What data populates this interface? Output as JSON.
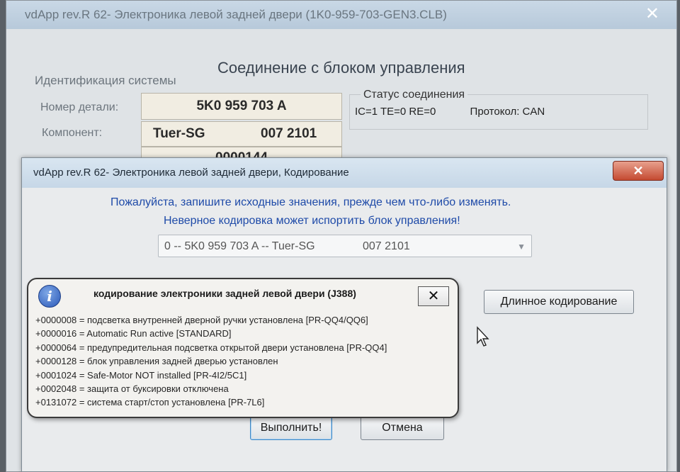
{
  "background_window": {
    "title": "vdApp rev.R 62- Электроника левой задней двери (1K0-959-703-GEN3.CLB)",
    "close_glyph": "✕",
    "heading": "Соединение с блоком управления",
    "system_id": {
      "group_label": "Идентификация системы",
      "part_number_label": "Номер детали:",
      "part_number_value": "5K0 959 703 A",
      "component_label": "Компонент:",
      "component_name": "Tuer-SG",
      "component_code": "007 2101",
      "extra_value": "0000144"
    },
    "status": {
      "legend": "Статус соединения",
      "text": "IC=1  TE=0   RE=0",
      "protocol": "Протокол: CAN"
    }
  },
  "dialog": {
    "title": "vdApp rev.R 62- Электроника левой задней двери,  Кодирование",
    "close_glyph": "✕",
    "message_line1": "Пожалуйста, запишите исходные значения, прежде чем что-либо изменять.",
    "message_line2": "Неверное кодировка может испортить блок управления!",
    "module_select": {
      "value": "0 -- 5K0 959 703 A -- Tuer-SG",
      "code": "007 2101"
    },
    "long_coding_button": "Длинное кодирование",
    "execute_button": "Выполнить!",
    "cancel_button": "Отмена"
  },
  "info_balloon": {
    "icon": "info-icon",
    "icon_glyph": "i",
    "title": "кодирование электроники задней левой двери (J388)",
    "close_glyph": "✕",
    "lines": [
      "+0000008 = подсветка внутренней дверной ручки установлена [PR-QQ4/QQ6]",
      "+0000016 = Automatic Run active [STANDARD]",
      "+0000064 = предупредительная подсветка открытой двери установлена [PR-QQ4]",
      "+0000128 = блок управления задней дверью установлен",
      "+0001024 = Safe-Motor NOT installed [PR-4I2/5C1]",
      "+0002048 = защита от буксировки отключена",
      "+0131072 = система старт/стоп установлена [PR-7L6]"
    ]
  },
  "colors": {
    "message_blue": "#1e4aa8",
    "close_red": "#c44a31",
    "info_blue": "#2a58b8"
  }
}
